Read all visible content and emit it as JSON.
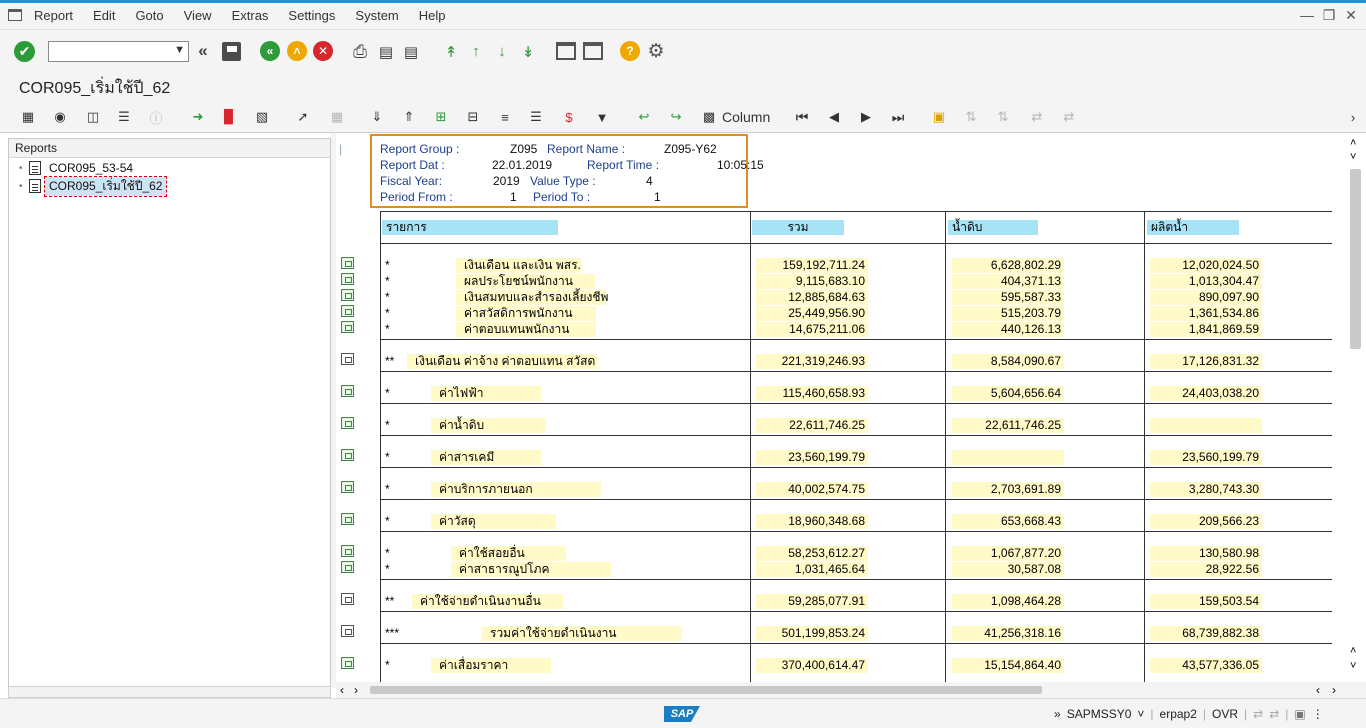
{
  "menu": [
    "Report",
    "Edit",
    "Goto",
    "View",
    "Extras",
    "Settings",
    "System",
    "Help"
  ],
  "command_field": {
    "value": ""
  },
  "title": "COR095_เริ่มใช้ปี_62",
  "app_toolbar": {
    "column_label": "Column"
  },
  "tree": {
    "header": "Reports",
    "items": [
      {
        "label": "COR095_53-54",
        "selected": false
      },
      {
        "label": "COR095_เริ่มใช้ปี_62",
        "selected": true
      }
    ]
  },
  "report_header": {
    "report_group_label": "Report Group :",
    "report_group": "Z095",
    "report_name_label": "Report Name :",
    "report_name": "Z095-Y62",
    "report_date_label": "Report Dat :",
    "report_date": "22.01.2019",
    "report_time_label": "Report Time :",
    "report_time": "10:05:15",
    "fiscal_year_label": "Fiscal Year:",
    "fiscal_year": "2019",
    "value_type_label": "Value Type :",
    "value_type": "4",
    "period_from_label": "Period From :",
    "period_from": "1",
    "period_to_label": "Period To :",
    "period_to": "1"
  },
  "columns": [
    "รายการ",
    "รวม",
    "น้ำดิบ",
    "ผลิตน้ำ"
  ],
  "rows": [
    {
      "star": "*",
      "label": "เงินเดือน และเงิน พสร.",
      "total": "159,192,711.24",
      "raw": "6,628,802.29",
      "prod": "12,020,024.50"
    },
    {
      "star": "*",
      "label": "ผลประโยชน์พนักงาน",
      "total": "9,115,683.10",
      "raw": "404,371.13",
      "prod": "1,013,304.47"
    },
    {
      "star": "*",
      "label": "เงินสมทบและสำรองเลี้ยงชีพ",
      "total": "12,885,684.63",
      "raw": "595,587.33",
      "prod": "890,097.90"
    },
    {
      "star": "*",
      "label": "ค่าสวัสดิการพนักงาน",
      "total": "25,449,956.90",
      "raw": "515,203.79",
      "prod": "1,361,534.86"
    },
    {
      "star": "*",
      "label": "ค่าตอบแทนพนักงาน",
      "total": "14,675,211.06",
      "raw": "440,126.13",
      "prod": "1,841,869.59"
    },
    {
      "star": "**",
      "label": "เงินเดือน ค่าจ้าง ค่าตอบแทน สวัสด",
      "total": "221,319,246.93",
      "raw": "8,584,090.67",
      "prod": "17,126,831.32"
    },
    {
      "star": "*",
      "label": "ค่าไฟฟ้า",
      "total": "115,460,658.93",
      "raw": "5,604,656.64",
      "prod": "24,403,038.20"
    },
    {
      "star": "*",
      "label": "ค่าน้ำดิบ",
      "total": "22,611,746.25",
      "raw": "22,611,746.25",
      "prod": ""
    },
    {
      "star": "*",
      "label": "ค่าสารเคมี",
      "total": "23,560,199.79",
      "raw": "",
      "prod": "23,560,199.79"
    },
    {
      "star": "*",
      "label": "ค่าบริการภายนอก",
      "total": "40,002,574.75",
      "raw": "2,703,691.89",
      "prod": "3,280,743.30"
    },
    {
      "star": "*",
      "label": "ค่าวัสดุ",
      "total": "18,960,348.68",
      "raw": "653,668.43",
      "prod": "209,566.23"
    },
    {
      "star": "*",
      "label": "ค่าใช้สอยอื่น",
      "total": "58,253,612.27",
      "raw": "1,067,877.20",
      "prod": "130,580.98"
    },
    {
      "star": "*",
      "label": "ค่าสาธารณูปโภค",
      "total": "1,031,465.64",
      "raw": "30,587.08",
      "prod": "28,922.56"
    },
    {
      "star": "**",
      "label": "ค่าใช้จ่ายดำเนินงานอื่น",
      "total": "59,285,077.91",
      "raw": "1,098,464.28",
      "prod": "159,503.54"
    },
    {
      "star": "***",
      "label": "รวมค่าใช้จ่ายดำเนินงาน",
      "total": "501,199,853.24",
      "raw": "41,256,318.16",
      "prod": "68,739,882.38"
    },
    {
      "star": "*",
      "label": "ค่าเสื่อมราคา",
      "total": "370,400,614.47",
      "raw": "15,154,864.40",
      "prod": "43,577,336.05"
    }
  ],
  "status": {
    "program": "SAPMSSY0",
    "server": "erpap2",
    "mode": "OVR"
  },
  "colors": {
    "accent_blue": "#1f8fd6",
    "header_box": "#e58c20",
    "cell_yellow": "#fffac8",
    "col_header": "#a8e3f5"
  }
}
